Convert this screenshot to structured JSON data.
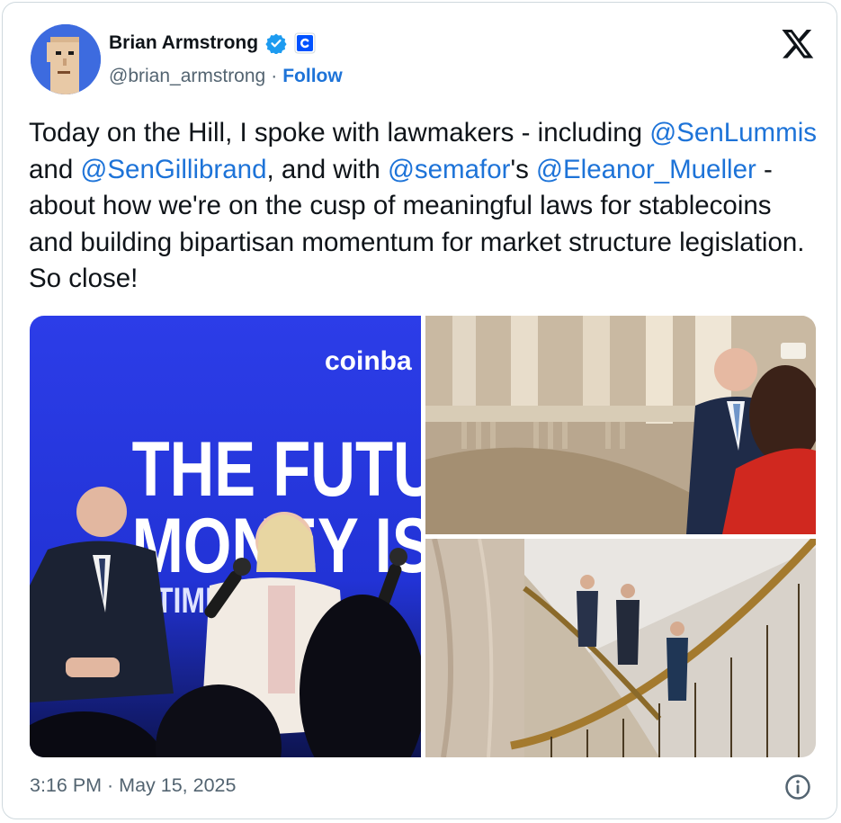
{
  "author": {
    "name": "Brian Armstrong",
    "handle": "@brian_armstrong",
    "separator": "·",
    "follow_label": "Follow",
    "verified_icon": "verified-badge-icon",
    "affiliate_icon": "coinbase-affiliate-icon"
  },
  "tweet": {
    "segments": [
      {
        "text": "Today on the Hill, I spoke with lawmakers - including ",
        "type": "text"
      },
      {
        "text": "@SenLummis",
        "type": "mention"
      },
      {
        "text": " and ",
        "type": "text"
      },
      {
        "text": "@SenGillibrand",
        "type": "mention"
      },
      {
        "text": ", and with ",
        "type": "text"
      },
      {
        "text": "@semafor",
        "type": "mention"
      },
      {
        "text": "'s ",
        "type": "text"
      },
      {
        "text": "@Eleanor_Mueller",
        "type": "mention"
      },
      {
        "text": " - about how we're on the cusp of meaningful laws for stablecoins and building bipartisan momentum for market structure legislation. So close!",
        "type": "text"
      }
    ]
  },
  "media": {
    "photo1": {
      "brand_text": "coinba",
      "banner_line1": "THE FUTU",
      "banner_line2": "MONEY IS",
      "banner_line3": "TIME"
    }
  },
  "footer": {
    "timestamp": "3:16 PM · May 15, 2025",
    "info_icon": "info-icon"
  },
  "colors": {
    "link": "#1d73d8",
    "secondary_text": "#536471",
    "verified": "#1d9bf0",
    "coinbase_blue": "#0052ff"
  }
}
